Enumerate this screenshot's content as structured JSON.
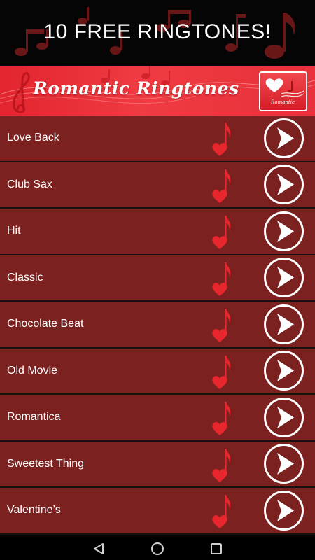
{
  "promo": {
    "title": "10 FREE RINGTONES!"
  },
  "header": {
    "title": "Romantic Ringtones",
    "icon_text": "Romantic"
  },
  "colors": {
    "header_red": "#e8313a",
    "row_bg": "#7b2220",
    "note_red": "#e8262d"
  },
  "ringtones": [
    {
      "name": "Love Back"
    },
    {
      "name": "Club Sax"
    },
    {
      "name": "Hit"
    },
    {
      "name": "Classic"
    },
    {
      "name": "Chocolate Beat"
    },
    {
      "name": "Old Movie"
    },
    {
      "name": "Romantica"
    },
    {
      "name": "Sweetest Thing"
    },
    {
      "name": "Valentine’s"
    }
  ],
  "icons": {
    "note": "heart-music-note-icon",
    "play": "play-icon",
    "back": "back-triangle-icon",
    "home": "home-circle-icon",
    "recents": "recents-square-icon"
  }
}
